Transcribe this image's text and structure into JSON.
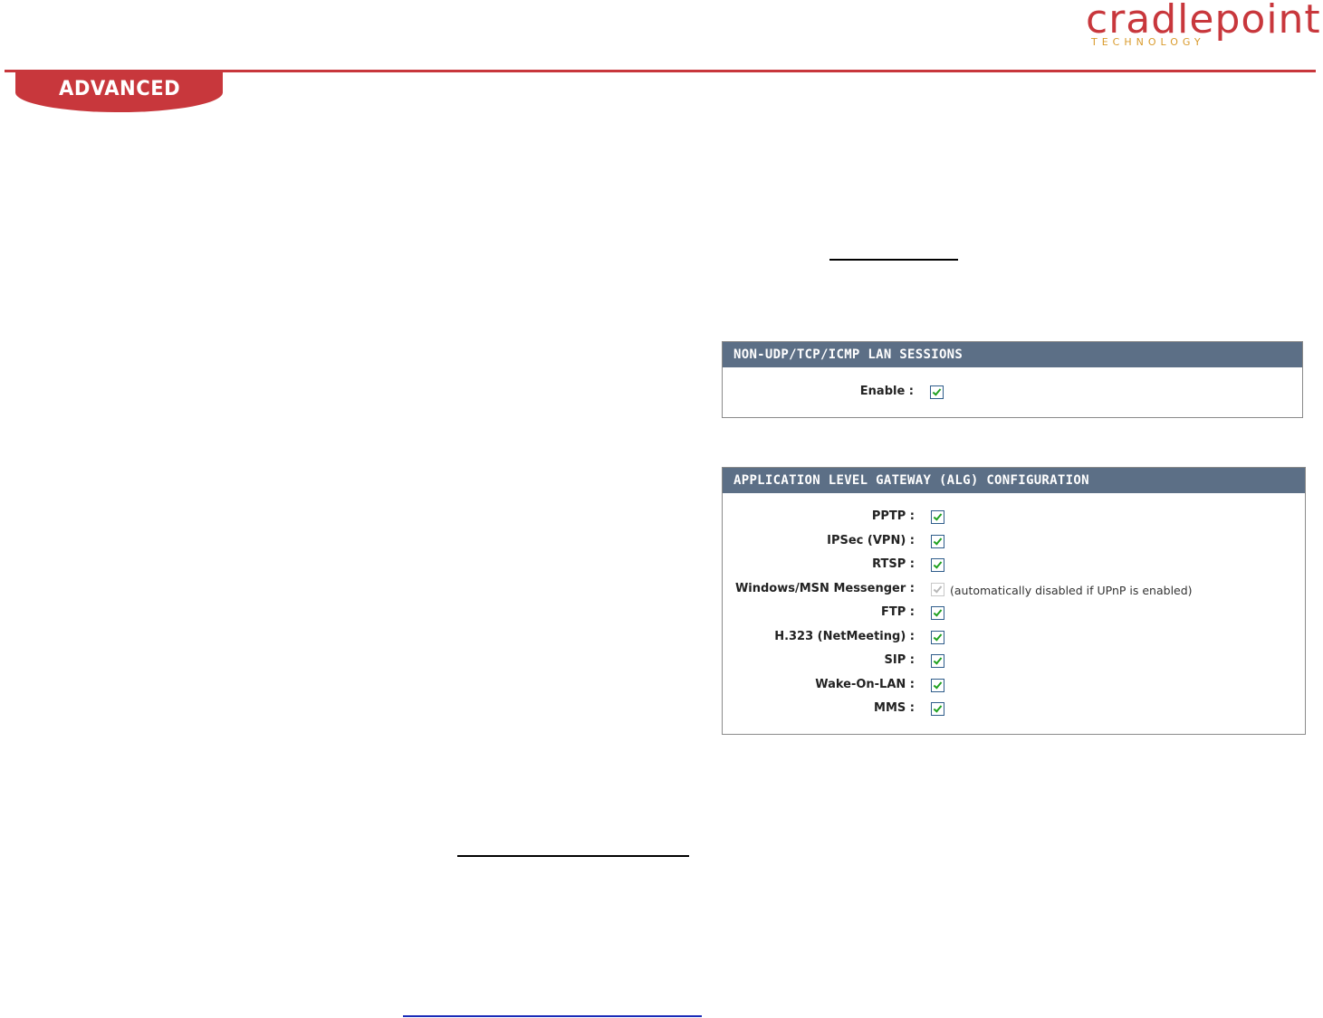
{
  "brand": {
    "logo_text": "cradlepoint",
    "logo_subtext": "TECHNOLOGY",
    "accent_color": "#c8373c",
    "sub_color": "#d99a2b"
  },
  "header": {
    "section_tab": "ADVANCED"
  },
  "lan_sessions_panel": {
    "title": "NON-UDP/TCP/ICMP LAN SESSIONS",
    "header_color": "#5c6f86",
    "enable_label": "Enable :",
    "enable_checked": true
  },
  "alg_panel": {
    "title": "APPLICATION LEVEL GATEWAY (ALG) CONFIGURATION",
    "rows": [
      {
        "label": "PPTP :",
        "checked": true,
        "disabled": false,
        "note": ""
      },
      {
        "label": "IPSec (VPN) :",
        "checked": true,
        "disabled": false,
        "note": ""
      },
      {
        "label": "RTSP :",
        "checked": true,
        "disabled": false,
        "note": ""
      },
      {
        "label": "Windows/MSN Messenger :",
        "checked": true,
        "disabled": true,
        "note": "(automatically disabled if UPnP is enabled)"
      },
      {
        "label": "FTP :",
        "checked": true,
        "disabled": false,
        "note": ""
      },
      {
        "label": "H.323 (NetMeeting) :",
        "checked": true,
        "disabled": false,
        "note": ""
      },
      {
        "label": "SIP :",
        "checked": true,
        "disabled": false,
        "note": ""
      },
      {
        "label": "Wake-On-LAN :",
        "checked": true,
        "disabled": false,
        "note": ""
      },
      {
        "label": "MMS :",
        "checked": true,
        "disabled": false,
        "note": ""
      }
    ]
  }
}
